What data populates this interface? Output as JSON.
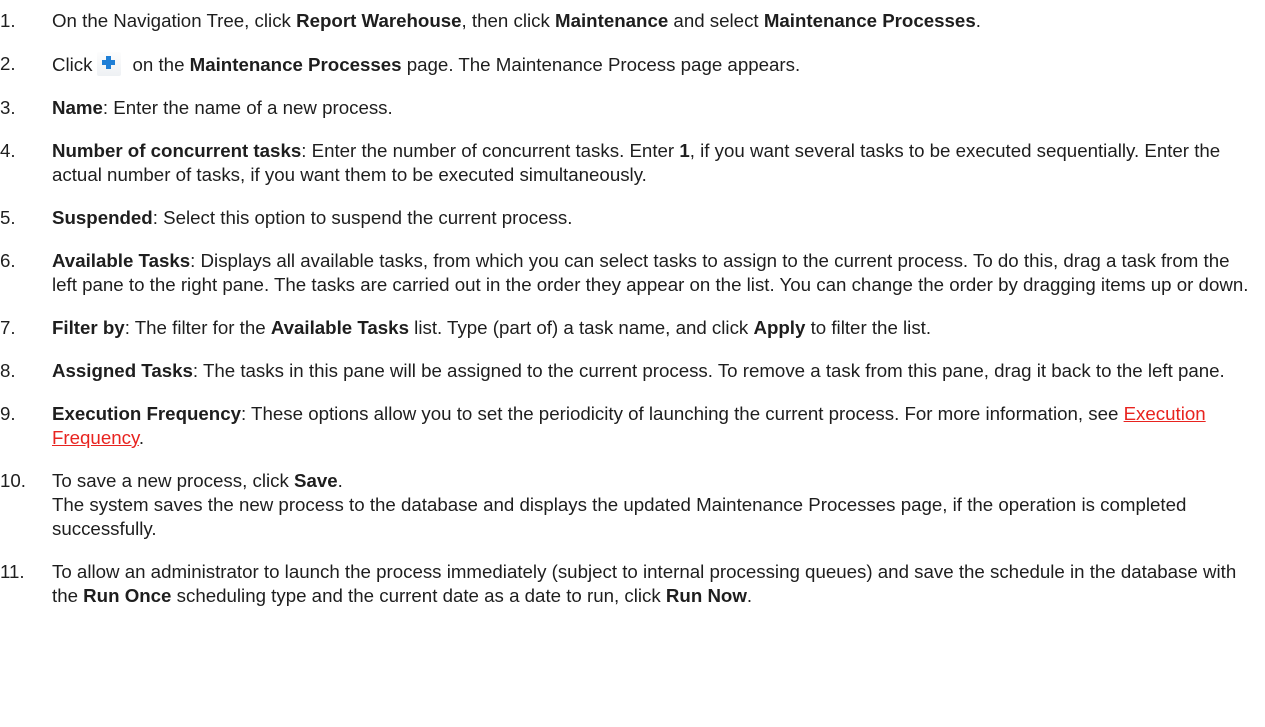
{
  "steps": [
    {
      "number": "1.",
      "t1": "On the Navigation Tree, click ",
      "b1": "Report Warehouse",
      "t2": ", then click ",
      "b2": "Maintenance",
      "t3": " and select ",
      "b3": "Maintenance Processes",
      "t4": "."
    },
    {
      "number": "2.",
      "t1": "Click",
      "icon": "add-plus-icon",
      "t2": "on the ",
      "b1": "Maintenance Processes",
      "t3": " page. The Maintenance Process page appears."
    },
    {
      "number": "3.",
      "b1": "Name",
      "t1": ": Enter the name of a new process."
    },
    {
      "number": "4.",
      "b1": "Number of concurrent tasks",
      "t1": ": Enter the number of concurrent tasks. Enter ",
      "b2": "1",
      "t2": ", if you want several tasks to be executed sequentially. Enter the actual number of tasks, if you want them to be executed simultaneously."
    },
    {
      "number": "5.",
      "b1": "Suspended",
      "t1": ": Select this option to suspend the current process."
    },
    {
      "number": "6.",
      "b1": "Available Tasks",
      "t1": ": Displays all available tasks, from which you can select tasks to assign to the current process. To do this, drag a task from the left pane to the right pane. The tasks are carried out in the order they appear on the list. You can change the order by dragging items up or down."
    },
    {
      "number": "7.",
      "b1": "Filter by",
      "t1": ": The filter for the ",
      "b2": "Available Tasks",
      "t2": " list. Type (part of) a task name, and click ",
      "b3": "Apply",
      "t3": " to filter the list."
    },
    {
      "number": "8.",
      "b1": "Assigned Tasks",
      "t1": ": The tasks in this pane will be assigned to the current process. To remove a task from this pane, drag it back to the left pane."
    },
    {
      "number": "9.",
      "b1": "Execution Frequency",
      "t1": ": These options allow you to set the periodicity of launching the current process. For more information, see ",
      "link": "Execution Frequency",
      "t2": "."
    },
    {
      "number": "10.",
      "t1": "To save a new process, click ",
      "b1": "Save",
      "t2": ".",
      "t3": "The system saves the new process to the database and displays the updated Maintenance Processes page, if the operation is completed successfully."
    },
    {
      "number": "11.",
      "t1": "To allow an administrator to launch the process immediately (subject to internal processing queues) and save the schedule in the database with the ",
      "b1": "Run Once",
      "t2": " scheduling type and the current date as a date to run, click ",
      "b2": "Run Now",
      "t3": "."
    }
  ],
  "colors": {
    "text": "#1e1e1e",
    "link": "#e8231f",
    "icon": "#1f7fd6"
  }
}
